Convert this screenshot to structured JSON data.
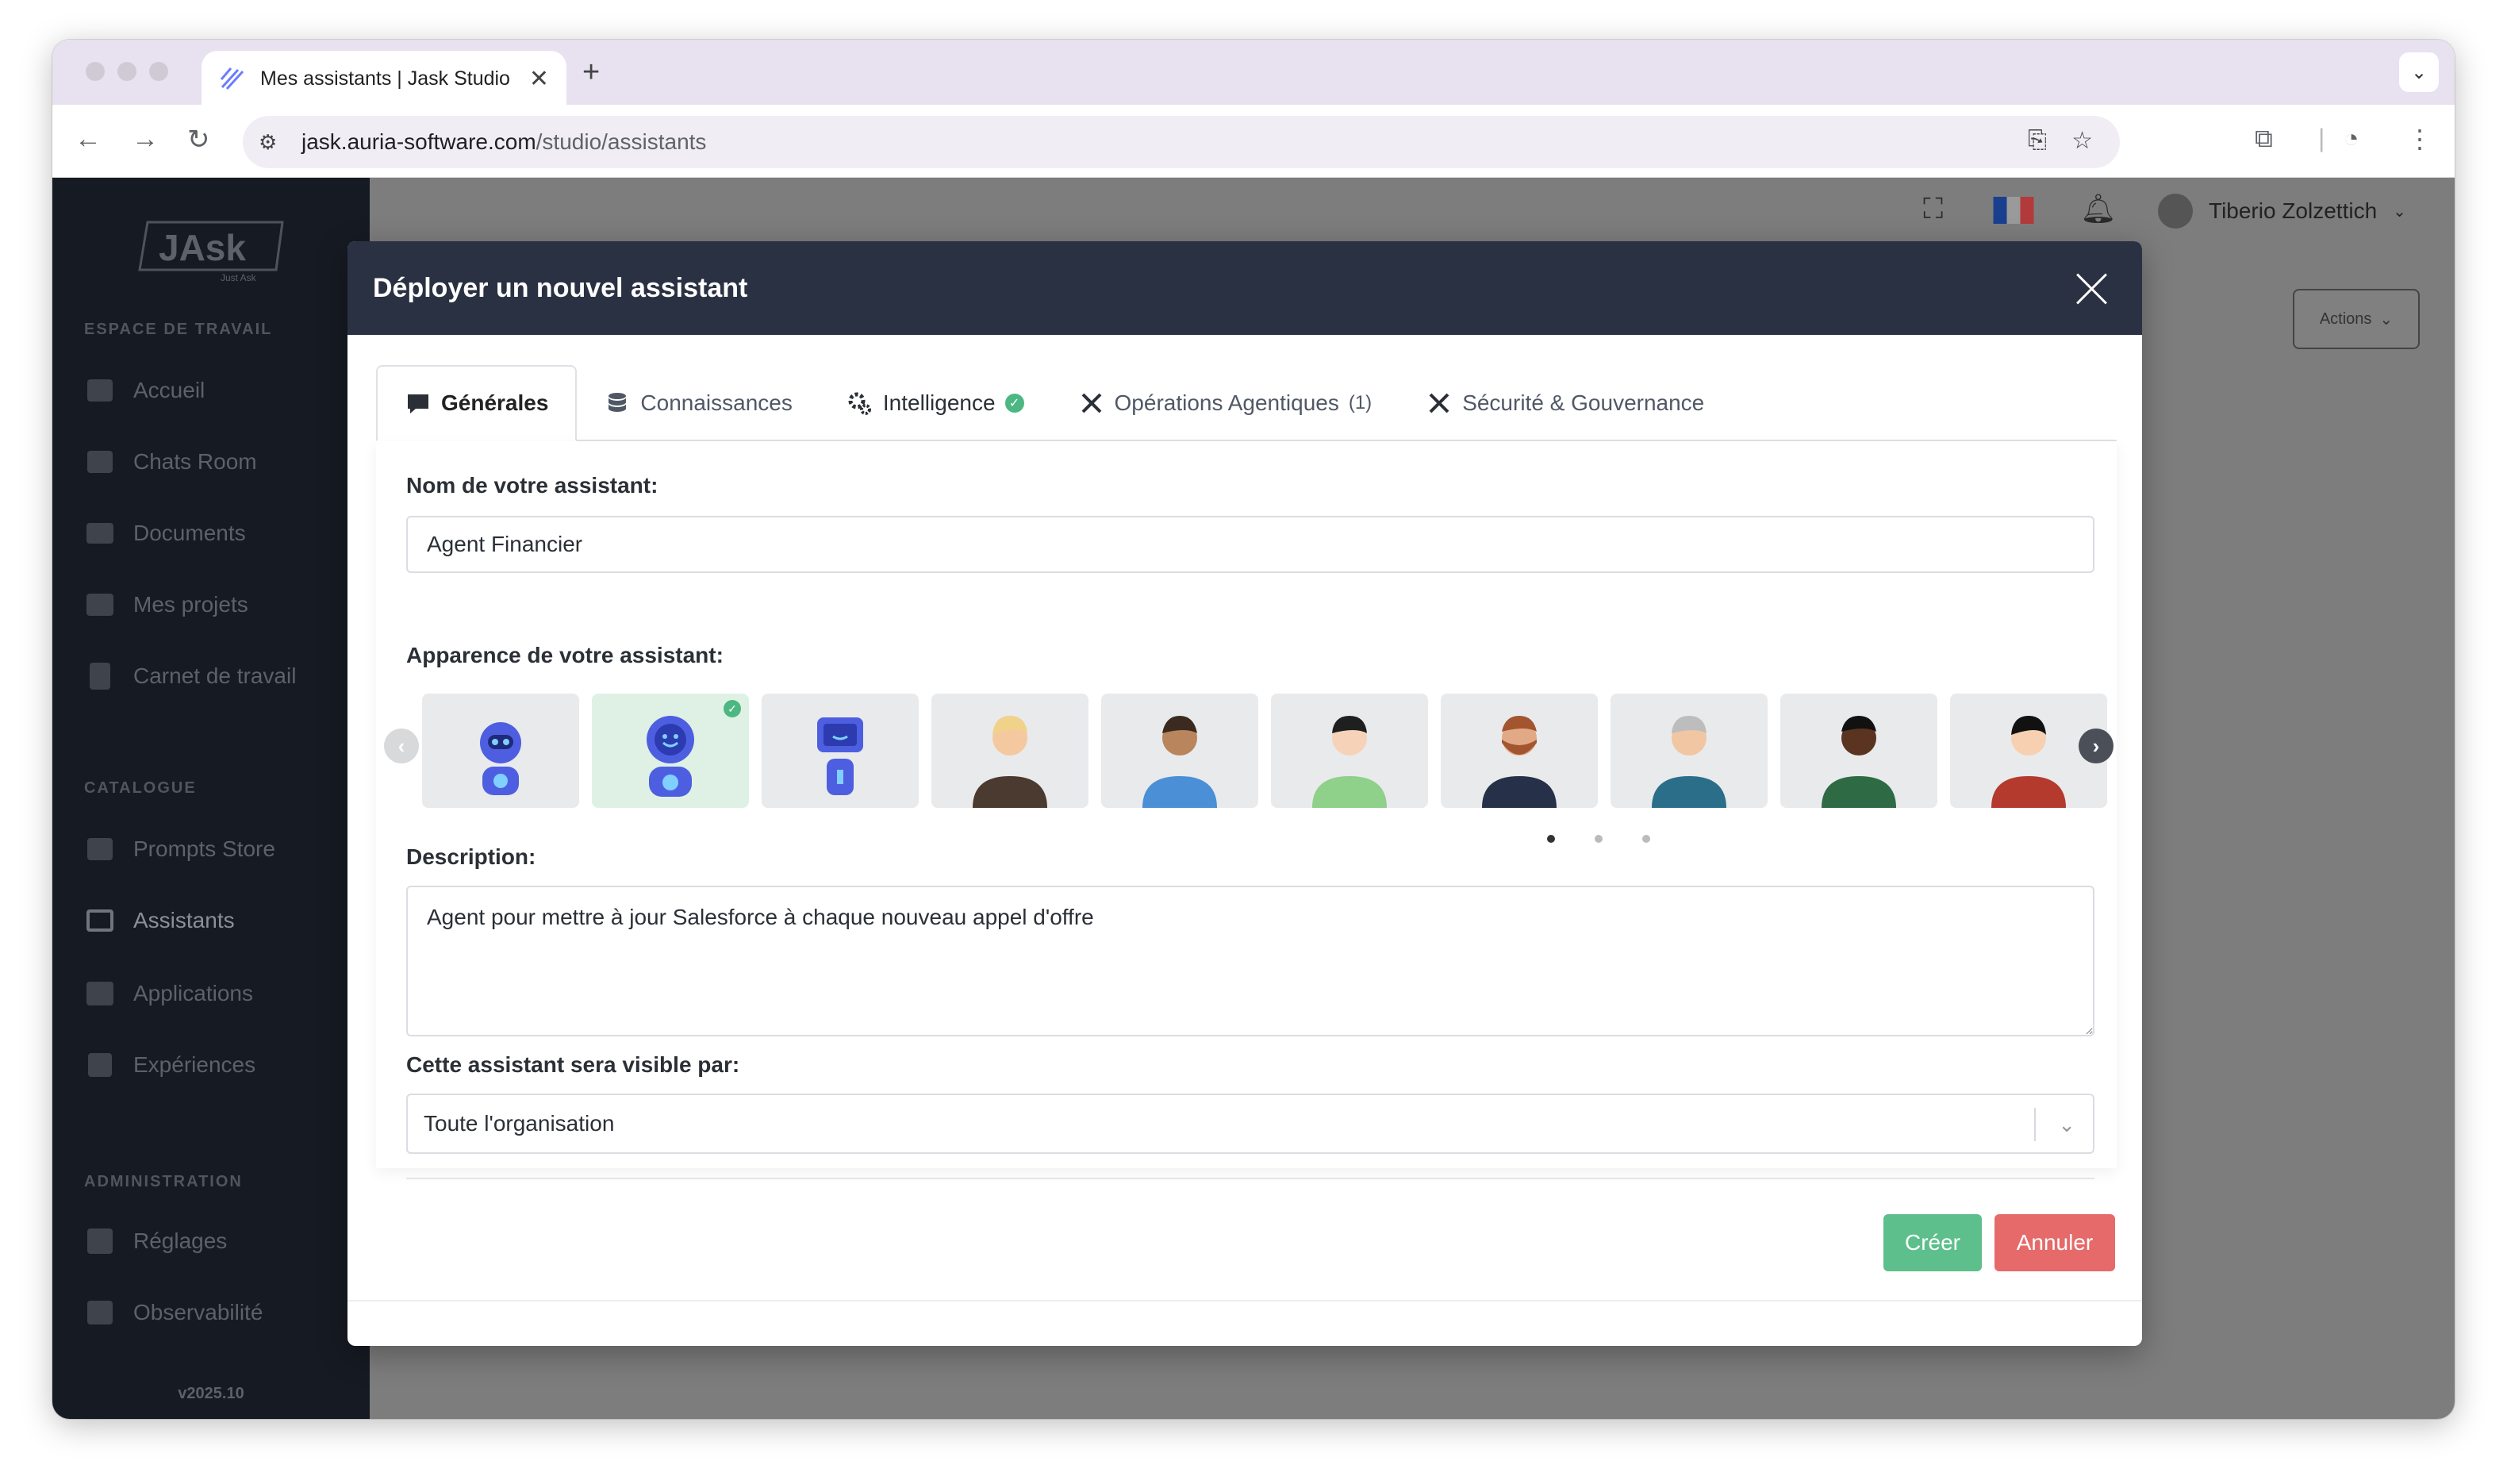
{
  "browser": {
    "tab_title": "Mes assistants | Jask Studio",
    "tab_close": "✕",
    "new_tab": "+",
    "url_host": "jask.auria-software.com",
    "url_path": "/studio/assistants"
  },
  "sidebar": {
    "logo_text": "JAsk",
    "logo_tagline": "Just Ask",
    "sections": {
      "workspace": "ESPACE DE TRAVAIL",
      "catalog": "CATALOGUE",
      "admin": "ADMINISTRATION"
    },
    "items": [
      {
        "label": "Accueil",
        "icon": "home-icon"
      },
      {
        "label": "Chats Room",
        "icon": "chat-icon"
      },
      {
        "label": "Documents",
        "icon": "folder-icon"
      },
      {
        "label": "Mes projets",
        "icon": "briefcase-icon"
      },
      {
        "label": "Carnet de travail",
        "icon": "clipboard-icon"
      },
      {
        "label": "Prompts Store",
        "icon": "prompt-icon"
      },
      {
        "label": "Assistants",
        "icon": "monitor-icon"
      },
      {
        "label": "Applications",
        "icon": "network-icon"
      },
      {
        "label": "Expériences",
        "icon": "tree-icon"
      },
      {
        "label": "Réglages",
        "icon": "tools-icon"
      },
      {
        "label": "Observabilité",
        "icon": "bar-chart-icon"
      }
    ],
    "version": "v2025.10"
  },
  "topbar": {
    "user_name": "Tiberio Zolzettich",
    "actions_label": "Actions"
  },
  "modal": {
    "title": "Déployer un nouvel assistant",
    "tabs": [
      {
        "label": "Générales",
        "active": true
      },
      {
        "label": "Connaissances"
      },
      {
        "label": "Intelligence",
        "ok": true
      },
      {
        "label": "Opérations Agentiques",
        "count": "(1)"
      },
      {
        "label": "Sécurité & Gouvernance"
      }
    ],
    "name_label": "Nom de votre assistant:",
    "name_value": "Agent Financier",
    "appearance_label": "Apparence de votre assistant:",
    "selected_avatar": 2,
    "avatar_count": 10,
    "pages": 3,
    "current_page": 1,
    "description_label": "Description:",
    "description_value": "Agent pour mettre à jour Salesforce à chaque nouveau appel d'offre",
    "visibility_label": "Cette assistant sera visible par:",
    "visibility_value": "Toute l'organisation",
    "create_label": "Créer",
    "cancel_label": "Annuler"
  },
  "colors": {
    "sidebar_bg": "#161a22",
    "modal_header": "#2a3142",
    "success": "#4cb782",
    "create_btn": "#5dbf8c",
    "cancel_btn": "#e66a6a"
  }
}
